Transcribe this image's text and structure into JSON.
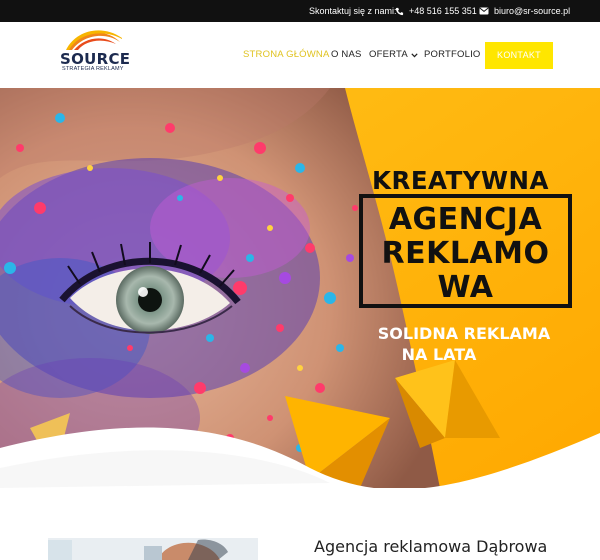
{
  "topbar": {
    "contact_label": "Skontaktuj się z nami:",
    "phone": "+48 516 155 351",
    "email": "biuro@sr-source.pl"
  },
  "logo": {
    "brand": "SOURCE",
    "tagline": "STRATEGIA REKLAMY"
  },
  "nav": {
    "home": "STRONA GŁÓWNA",
    "about": "O NAS",
    "offer": "OFERTA",
    "portfolio": "PORTFOLIO",
    "contact": "KONTAKT"
  },
  "hero": {
    "headline": "KREATYWNA",
    "boxed_lines": [
      "AGENCJA",
      "REKLAMO",
      "WA"
    ],
    "sub_lines": [
      "SOLIDNA REKLAMA",
      "NA LATA"
    ]
  },
  "section": {
    "title": "Agencja reklamowa Dąbrowa"
  },
  "colors": {
    "accent_yellow": "#ffe600",
    "hero_yellow": "#ffb800",
    "topbar": "#111111",
    "logo_navy": "#1c2a4f"
  },
  "icons": {
    "phone": "phone-icon",
    "email": "envelope-icon",
    "offer_dropdown": "chevron-down-icon"
  }
}
